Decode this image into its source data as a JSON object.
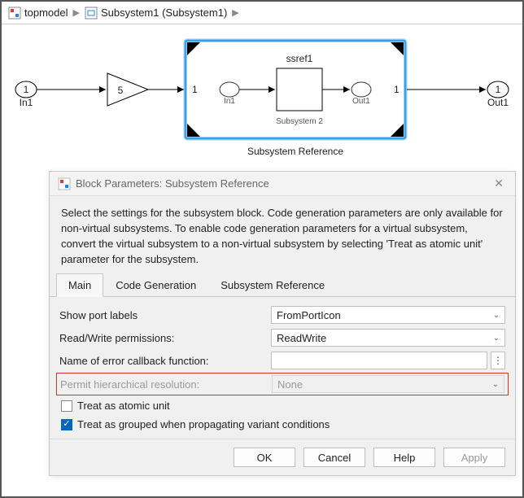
{
  "breadcrumb": {
    "item1": "topmodel",
    "item2": "Subsystem1 (Subsystem1)"
  },
  "canvas": {
    "in_port_num": "1",
    "in_port_label": "In1",
    "gain_value": "5",
    "subsys_in_port": "1",
    "subsys_in_label": "In1",
    "inner_block_title": "ssref1",
    "inner_block_label": "Subsystem 2",
    "subsys_out_label": "Out1",
    "subsys_out_port": "1",
    "subsys_ref_label": "Subsystem Reference",
    "out_port_num": "1",
    "out_port_label": "Out1"
  },
  "dialog": {
    "title": "Block Parameters: Subsystem Reference",
    "description": "Select the settings for the subsystem block. Code generation parameters are only available for non-virtual subsystems. To enable code generation parameters for a virtual subsystem, convert the virtual subsystem to a non-virtual subsystem by selecting 'Treat as atomic unit' parameter for the subsystem.",
    "tabs": {
      "main": "Main",
      "codegen": "Code Generation",
      "subsysref": "Subsystem Reference"
    },
    "fields": {
      "show_port_labels": {
        "label": "Show port labels",
        "value": "FromPortIcon"
      },
      "rw_permissions": {
        "label": "Read/Write permissions:",
        "value": "ReadWrite"
      },
      "error_callback": {
        "label": "Name of error callback function:",
        "value": ""
      },
      "permit_hier": {
        "label": "Permit hierarchical resolution:",
        "value": "None"
      },
      "treat_atomic": {
        "label": "Treat as atomic unit",
        "checked": false
      },
      "treat_grouped": {
        "label": "Treat as grouped when propagating variant conditions",
        "checked": true
      }
    },
    "buttons": {
      "ok": "OK",
      "cancel": "Cancel",
      "help": "Help",
      "apply": "Apply"
    }
  }
}
